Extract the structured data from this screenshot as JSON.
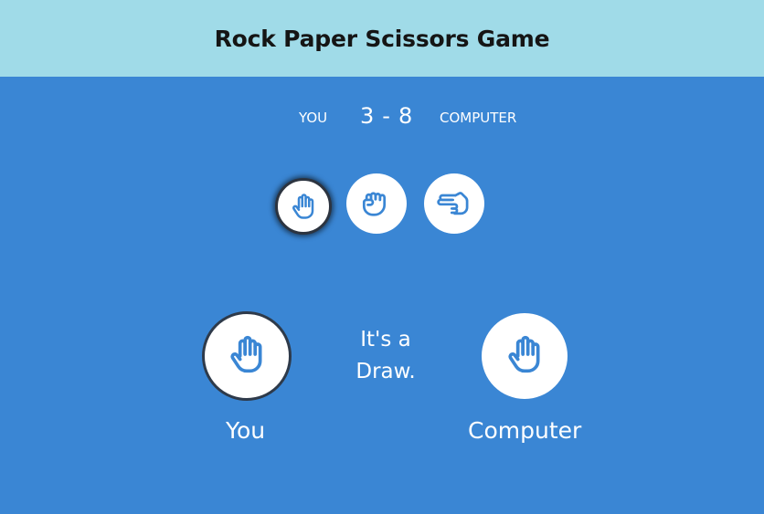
{
  "header": {
    "title": "Rock Paper Scissors Game"
  },
  "scoreboard": {
    "you_label": "YOU",
    "computer_label": "COMPUTER",
    "you_score": "3",
    "separator": "-",
    "computer_score": "8"
  },
  "choices": [
    {
      "name": "paper",
      "icon": "hand-paper-icon",
      "selected": true
    },
    {
      "name": "rock",
      "icon": "hand-rock-icon",
      "selected": false
    },
    {
      "name": "scissors",
      "icon": "hand-scissors-icon",
      "selected": false
    }
  ],
  "round": {
    "you_choice_icon": "hand-paper-icon",
    "computer_choice_icon": "hand-paper-icon",
    "result_line1": "It's a",
    "result_line2": "Draw.",
    "you_name": "You",
    "computer_name": "Computer"
  },
  "colors": {
    "background": "#3a86d4",
    "header": "#a0dbe8",
    "icon": "#3a86d4"
  }
}
